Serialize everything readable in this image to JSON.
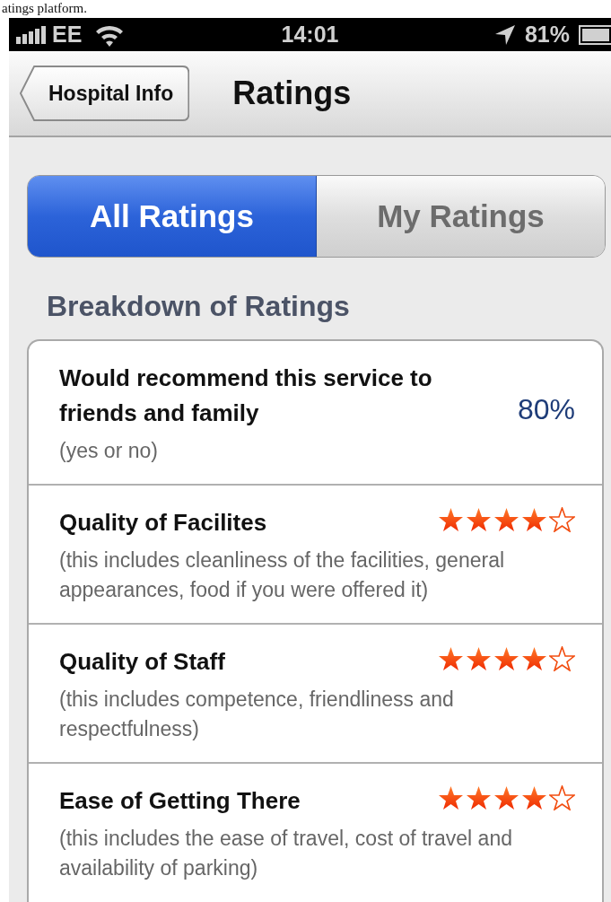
{
  "caption": "atings platform.",
  "status_bar": {
    "carrier": "EE",
    "time": "14:01",
    "battery": "81%"
  },
  "nav_bar": {
    "back": "Hospital Info",
    "title": "Ratings"
  },
  "tabs": [
    {
      "label": "All Ratings",
      "selected": true
    },
    {
      "label": "My Ratings",
      "selected": false
    }
  ],
  "section_title": "Breakdown of Ratings",
  "rows": [
    {
      "kind": "percent",
      "title": "Would recommend this service to friends and family",
      "note": "(yes or no)",
      "value": "80%"
    },
    {
      "kind": "stars",
      "title": "Quality of Facilites",
      "note": "(this includes cleanliness of the facilities, general appearances, food if you were offered it)",
      "stars": 4
    },
    {
      "kind": "stars",
      "title": "Quality of Staff",
      "note": "(this includes competence, friendliness and respectfulness)",
      "stars": 4
    },
    {
      "kind": "stars",
      "title": "Ease of Getting There",
      "note": "(this includes the ease of travel, cost of travel and availability of parking)",
      "stars": 4
    }
  ]
}
